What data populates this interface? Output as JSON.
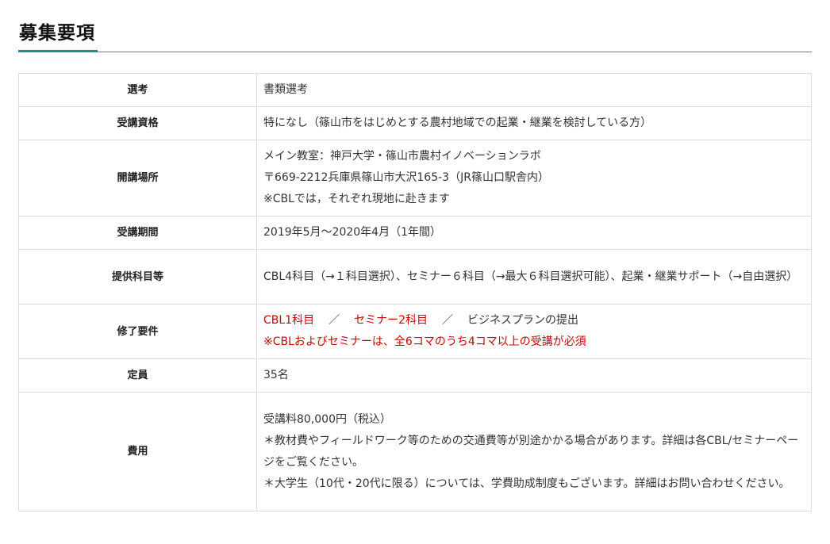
{
  "page": {
    "title": "募集要項"
  },
  "colors": {
    "accent": "#168f84",
    "emphasis": "#cc0000",
    "border": "#dcdcdc"
  },
  "rows": [
    {
      "label": "選考",
      "lines": [
        "書類選考"
      ]
    },
    {
      "label": "受講資格",
      "lines": [
        "特になし（篠山市をはじめとする農村地域での起業・継業を検討している方）"
      ]
    },
    {
      "label": "開講場所",
      "lines": [
        "メイン教室：神戸大学・篠山市農村イノベーションラボ",
        "〒669-2212兵庫県篠山市大沢165-3（JR篠山口駅舎内）",
        "※CBLでは，それぞれ現地に赴きます"
      ]
    },
    {
      "label": "受講期間",
      "lines": [
        "2019年5月～2020年4月（1年間）"
      ]
    },
    {
      "label": "提供科目等",
      "lines": [
        "CBL4科目（→１科目選択）、セミナー６科目（→最大６科目選択可能）、起業・継業サポート（→自由選択）"
      ]
    },
    {
      "label": "修了要件",
      "parts": [
        "CBL1科目",
        "／",
        "セミナー2科目",
        "／",
        "ビジネスプランの提出"
      ],
      "note": "※CBLおよびセミナーは、全6コマのうち4コマ以上の受講が必須"
    },
    {
      "label": "定員",
      "lines": [
        "35名"
      ]
    },
    {
      "label": "費用",
      "lines": [
        "受講料80,000円（税込）",
        "＊教材費やフィールドワーク等のための交通費等が別途かかる場合があります。詳細は各CBL/セミナーページをご覧ください。",
        "＊大学生（10代・20代に限る）については、学費助成制度もございます。詳細はお問い合わせください。"
      ]
    }
  ]
}
